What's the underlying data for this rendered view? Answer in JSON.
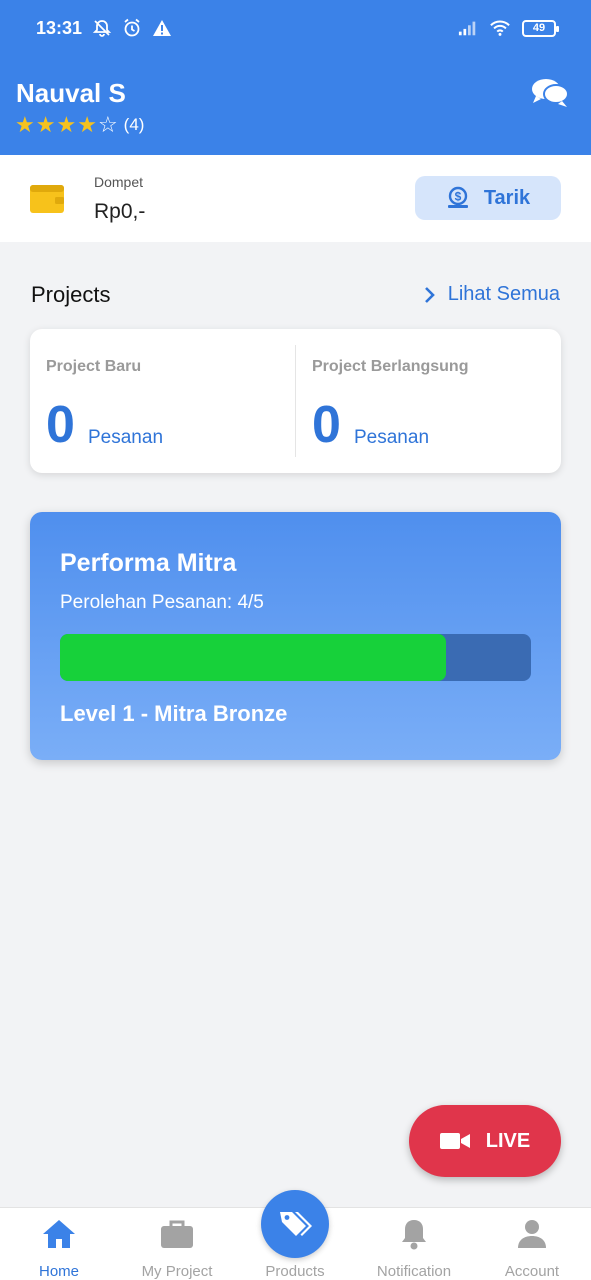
{
  "status_bar": {
    "time": "13:31",
    "battery": "49",
    "icons": [
      "bell-off-icon",
      "alarm-icon",
      "warning-icon",
      "signal-icon",
      "wifi-icon",
      "battery-icon"
    ]
  },
  "header": {
    "name": "Nauval S",
    "rating_stars": 4,
    "rating_max": 5,
    "rating_count": "(4)",
    "chat_icon": "chat-icon"
  },
  "wallet": {
    "label": "Dompet",
    "amount": "Rp0,-",
    "withdraw_label": "Tarik"
  },
  "projects": {
    "title": "Projects",
    "see_all": "Lihat Semua",
    "new": {
      "label": "Project Baru",
      "count": "0",
      "unit": "Pesanan"
    },
    "ongoing": {
      "label": "Project Berlangsung",
      "count": "0",
      "unit": "Pesanan"
    }
  },
  "performance": {
    "title": "Performa Mitra",
    "subtitle": "Perolehan Pesanan: 4/5",
    "progress": 0.82,
    "level": "Level 1 - Mitra Bronze"
  },
  "live_button": {
    "label": "LIVE"
  },
  "nav": [
    {
      "label": "Home",
      "active": true
    },
    {
      "label": "My Project",
      "active": false
    },
    {
      "label": "Products",
      "active": false
    },
    {
      "label": "Notification",
      "active": false
    },
    {
      "label": "Account",
      "active": false
    }
  ],
  "colors": {
    "primary": "#3b82e8",
    "progress": "#17d13a",
    "live": "#e0354b",
    "star": "#f5c220"
  }
}
